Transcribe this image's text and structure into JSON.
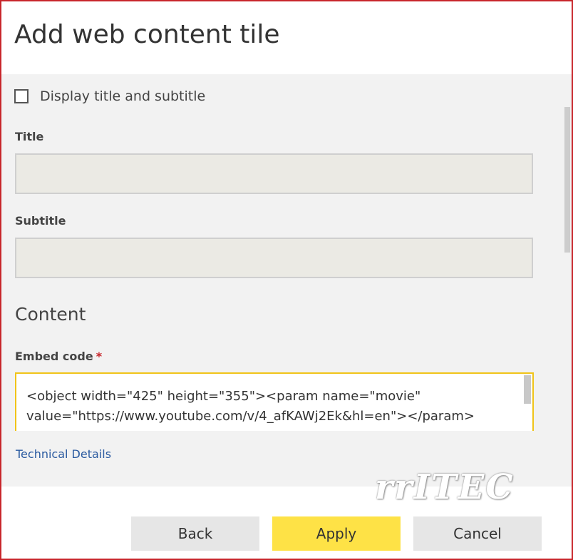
{
  "dialog": {
    "title": "Add web content tile"
  },
  "form": {
    "display_title_label": "Display title and subtitle",
    "title_label": "Title",
    "title_value": "",
    "subtitle_label": "Subtitle",
    "subtitle_value": "",
    "content_heading": "Content",
    "embed_label": "Embed code",
    "embed_required": "*",
    "embed_value": "<object width=\"425\" height=\"355\"><param name=\"movie\" value=\"https://www.youtube.com/v/4_afKAWj2Ek&hl=en\"></param>",
    "technical_details": "Technical Details"
  },
  "watermark": "rrITEC",
  "buttons": {
    "back": "Back",
    "apply": "Apply",
    "cancel": "Cancel"
  },
  "colors": {
    "accent": "#fee246",
    "border": "#c8262b",
    "focus": "#f0c419",
    "link": "#2a5aa0"
  }
}
